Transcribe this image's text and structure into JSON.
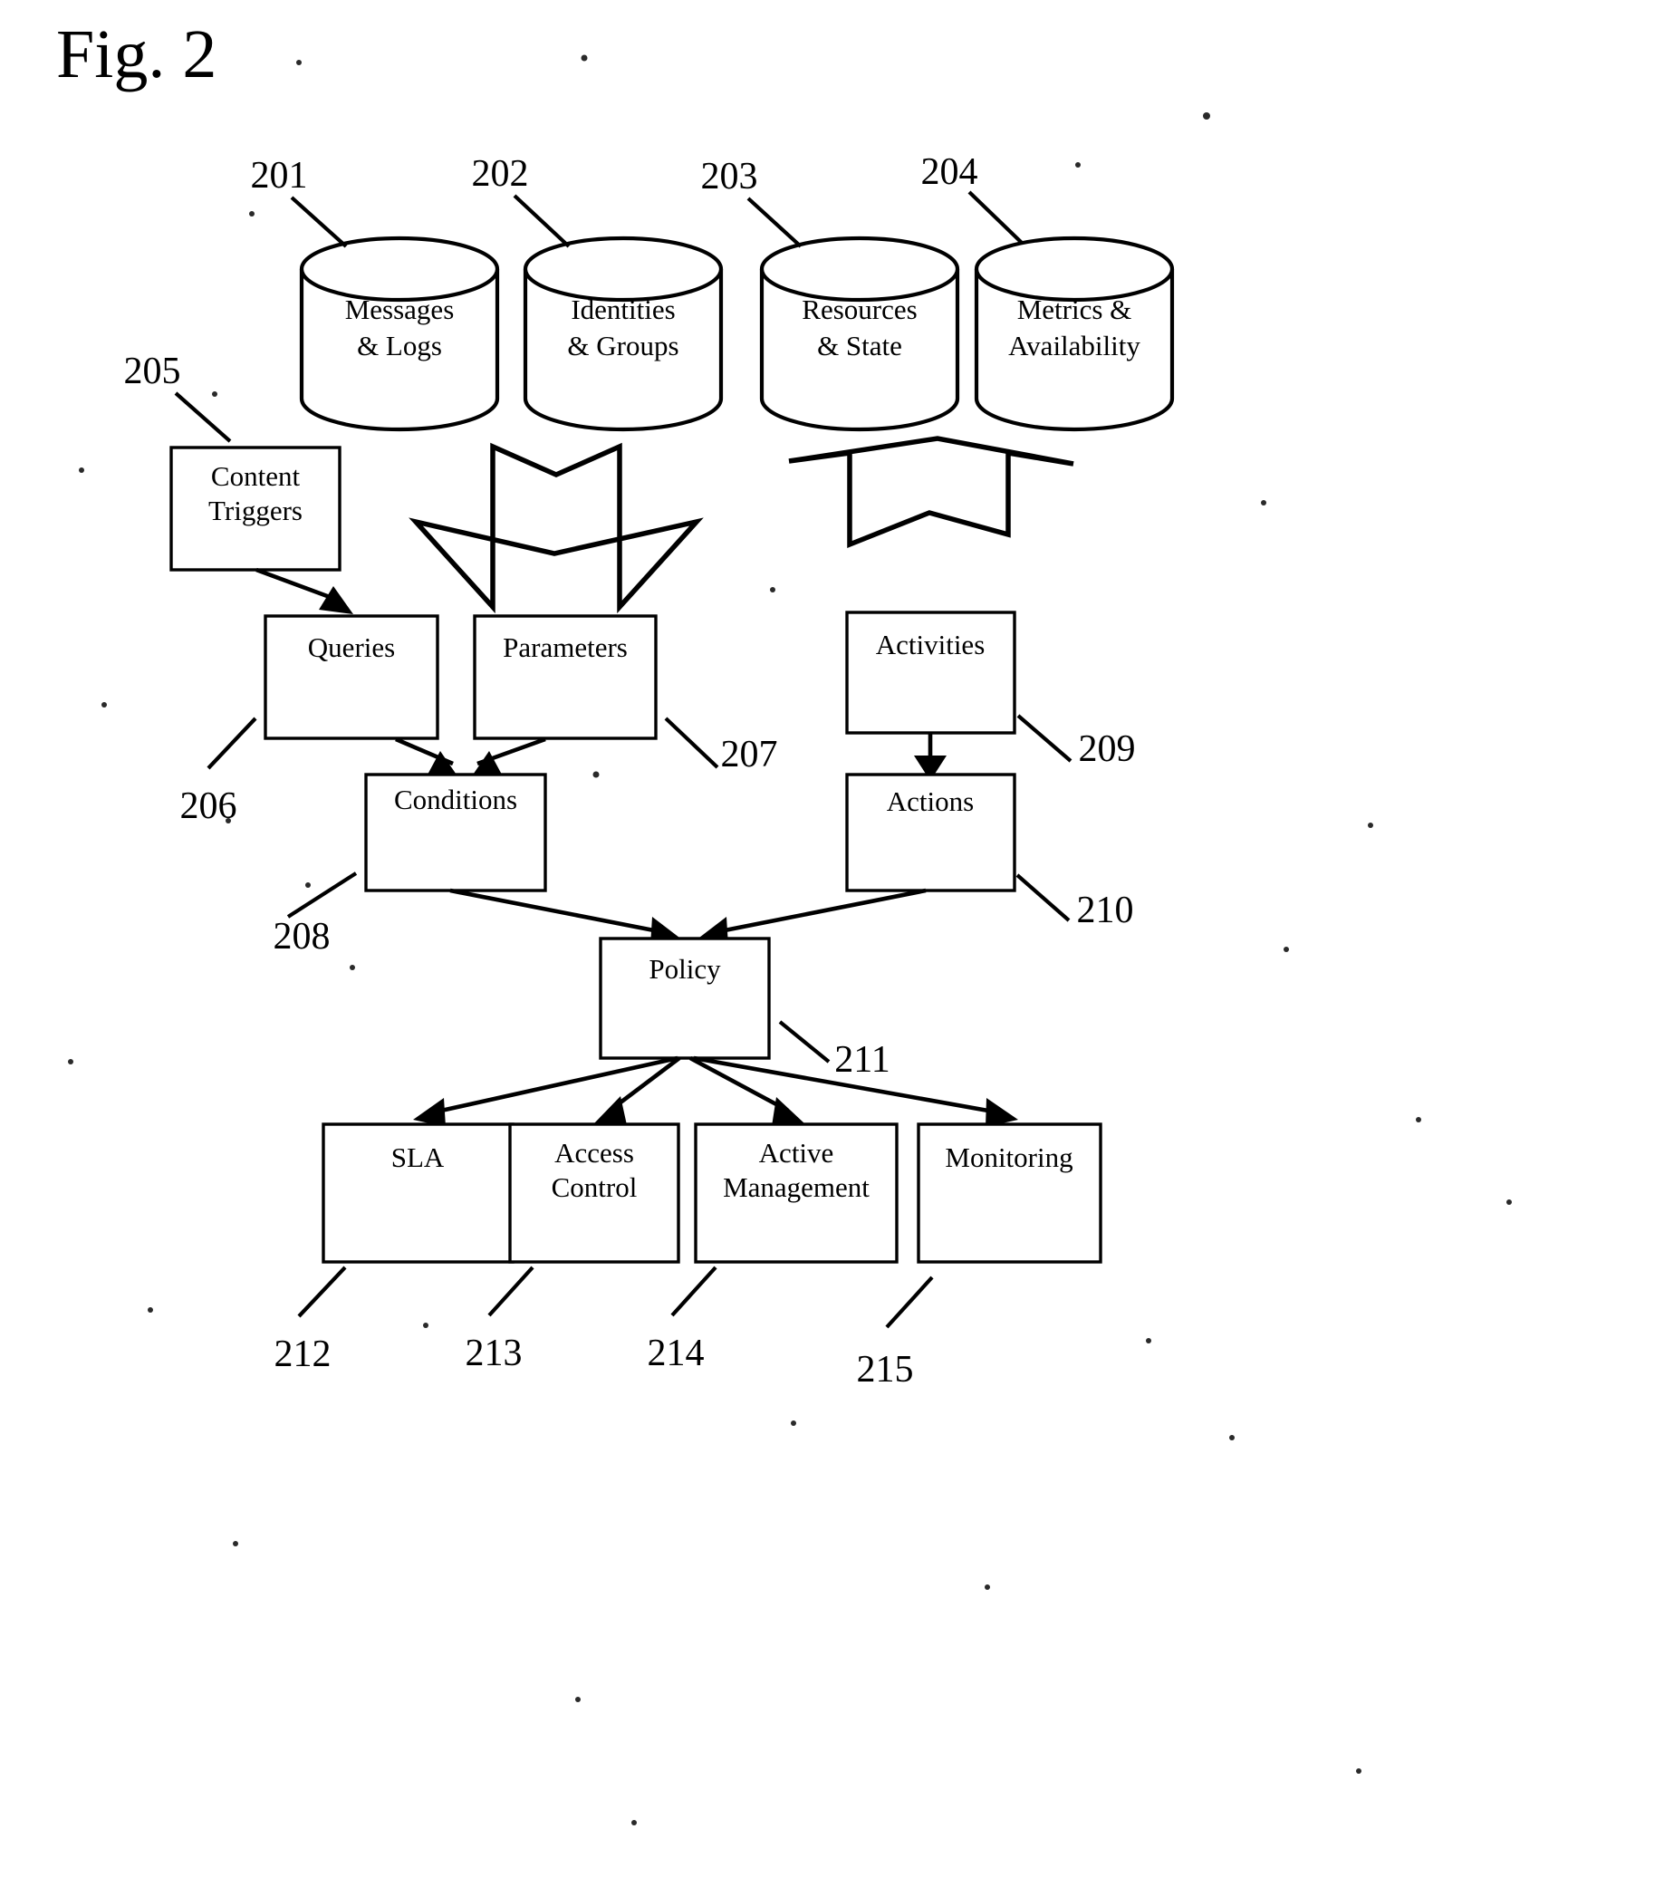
{
  "figure": {
    "title": "Fig. 2"
  },
  "data_stores": [
    {
      "ref": "201",
      "line1": "Messages",
      "line2": "& Logs"
    },
    {
      "ref": "202",
      "line1": "Identities",
      "line2": "& Groups"
    },
    {
      "ref": "203",
      "line1": "Resources",
      "line2": "& State"
    },
    {
      "ref": "204",
      "line1": "Metrics &",
      "line2": "Availability"
    }
  ],
  "nodes": [
    {
      "ref": "205",
      "line1": "Content",
      "line2": "Triggers"
    },
    {
      "ref": "206",
      "line1": "Queries",
      "line2": ""
    },
    {
      "ref": "207",
      "line1": "Parameters",
      "line2": ""
    },
    {
      "ref": "208",
      "line1": "Conditions",
      "line2": ""
    },
    {
      "ref": "209",
      "line1": "Activities",
      "line2": ""
    },
    {
      "ref": "210",
      "line1": "Actions",
      "line2": ""
    },
    {
      "ref": "211",
      "line1": "Policy",
      "line2": ""
    },
    {
      "ref": "212",
      "line1": "SLA",
      "line2": ""
    },
    {
      "ref": "213",
      "line1": "Access",
      "line2": "Control"
    },
    {
      "ref": "214",
      "line1": "Active",
      "line2": "Management"
    },
    {
      "ref": "215",
      "line1": "Monitoring",
      "line2": ""
    }
  ],
  "reference_numerals": [
    "201",
    "202",
    "203",
    "204",
    "205",
    "206",
    "207",
    "208",
    "209",
    "210",
    "211",
    "212",
    "213",
    "214",
    "215"
  ],
  "colors": {
    "ink": "#000000",
    "background": "#ffffff"
  }
}
